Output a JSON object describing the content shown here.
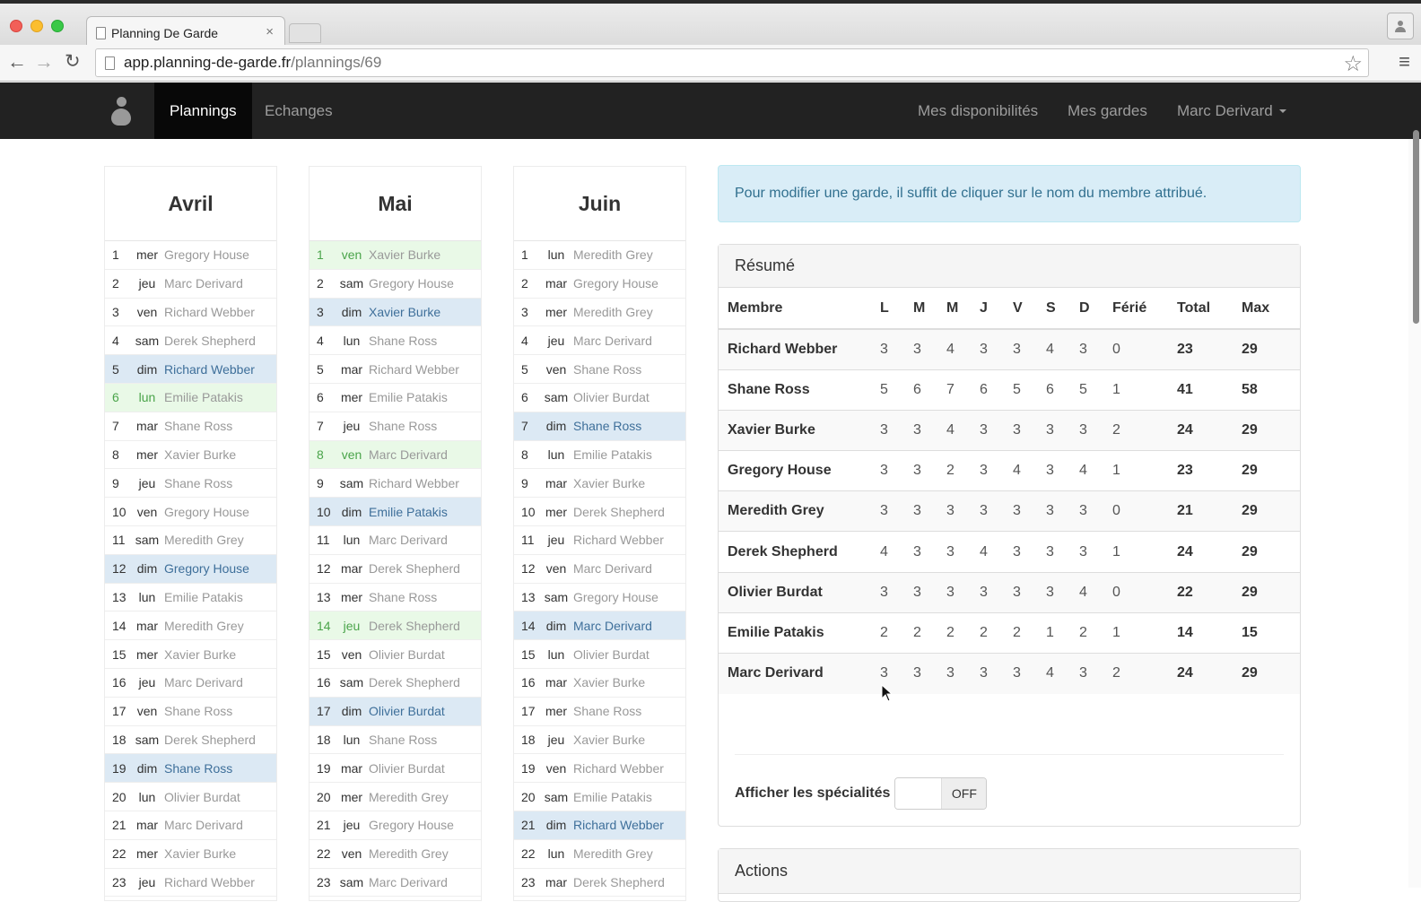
{
  "browser": {
    "tab_title": "Planning De Garde",
    "tab_close": "×",
    "url_host": "app.planning-de-garde.fr",
    "url_path": "/plannings/69",
    "back": "←",
    "forward": "→",
    "reload": "↻",
    "star": "☆",
    "menu": "≡",
    "profile": "👤"
  },
  "navbar": {
    "items_left": [
      {
        "label": "Plannings",
        "active": true
      },
      {
        "label": "Echanges",
        "active": false
      }
    ],
    "items_right": [
      {
        "label": "Mes disponibilités"
      },
      {
        "label": "Mes gardes"
      },
      {
        "label": "Marc Derivard"
      }
    ]
  },
  "months": [
    {
      "name": "Avril",
      "days": [
        {
          "num": "1",
          "day": "mer",
          "member": "Gregory House",
          "type": "normal"
        },
        {
          "num": "2",
          "day": "jeu",
          "member": "Marc Derivard",
          "type": "normal"
        },
        {
          "num": "3",
          "day": "ven",
          "member": "Richard Webber",
          "type": "normal"
        },
        {
          "num": "4",
          "day": "sam",
          "member": "Derek Shepherd",
          "type": "normal"
        },
        {
          "num": "5",
          "day": "dim",
          "member": "Richard Webber",
          "type": "sunday"
        },
        {
          "num": "6",
          "day": "lun",
          "member": "Emilie Patakis",
          "type": "holiday"
        },
        {
          "num": "7",
          "day": "mar",
          "member": "Shane Ross",
          "type": "normal"
        },
        {
          "num": "8",
          "day": "mer",
          "member": "Xavier Burke",
          "type": "normal"
        },
        {
          "num": "9",
          "day": "jeu",
          "member": "Shane Ross",
          "type": "normal"
        },
        {
          "num": "10",
          "day": "ven",
          "member": "Gregory House",
          "type": "normal"
        },
        {
          "num": "11",
          "day": "sam",
          "member": "Meredith Grey",
          "type": "normal"
        },
        {
          "num": "12",
          "day": "dim",
          "member": "Gregory House",
          "type": "sunday"
        },
        {
          "num": "13",
          "day": "lun",
          "member": "Emilie Patakis",
          "type": "normal"
        },
        {
          "num": "14",
          "day": "mar",
          "member": "Meredith Grey",
          "type": "normal"
        },
        {
          "num": "15",
          "day": "mer",
          "member": "Xavier Burke",
          "type": "normal"
        },
        {
          "num": "16",
          "day": "jeu",
          "member": "Marc Derivard",
          "type": "normal"
        },
        {
          "num": "17",
          "day": "ven",
          "member": "Shane Ross",
          "type": "normal"
        },
        {
          "num": "18",
          "day": "sam",
          "member": "Derek Shepherd",
          "type": "normal"
        },
        {
          "num": "19",
          "day": "dim",
          "member": "Shane Ross",
          "type": "sunday"
        },
        {
          "num": "20",
          "day": "lun",
          "member": "Olivier Burdat",
          "type": "normal"
        },
        {
          "num": "21",
          "day": "mar",
          "member": "Marc Derivard",
          "type": "normal"
        },
        {
          "num": "22",
          "day": "mer",
          "member": "Xavier Burke",
          "type": "normal"
        },
        {
          "num": "23",
          "day": "jeu",
          "member": "Richard Webber",
          "type": "normal"
        }
      ]
    },
    {
      "name": "Mai",
      "days": [
        {
          "num": "1",
          "day": "ven",
          "member": "Xavier Burke",
          "type": "holiday"
        },
        {
          "num": "2",
          "day": "sam",
          "member": "Gregory House",
          "type": "normal"
        },
        {
          "num": "3",
          "day": "dim",
          "member": "Xavier Burke",
          "type": "sunday"
        },
        {
          "num": "4",
          "day": "lun",
          "member": "Shane Ross",
          "type": "normal"
        },
        {
          "num": "5",
          "day": "mar",
          "member": "Richard Webber",
          "type": "normal"
        },
        {
          "num": "6",
          "day": "mer",
          "member": "Emilie Patakis",
          "type": "normal"
        },
        {
          "num": "7",
          "day": "jeu",
          "member": "Shane Ross",
          "type": "normal"
        },
        {
          "num": "8",
          "day": "ven",
          "member": "Marc Derivard",
          "type": "holiday"
        },
        {
          "num": "9",
          "day": "sam",
          "member": "Richard Webber",
          "type": "normal"
        },
        {
          "num": "10",
          "day": "dim",
          "member": "Emilie Patakis",
          "type": "sunday"
        },
        {
          "num": "11",
          "day": "lun",
          "member": "Marc Derivard",
          "type": "normal"
        },
        {
          "num": "12",
          "day": "mar",
          "member": "Derek Shepherd",
          "type": "normal"
        },
        {
          "num": "13",
          "day": "mer",
          "member": "Shane Ross",
          "type": "normal"
        },
        {
          "num": "14",
          "day": "jeu",
          "member": "Derek Shepherd",
          "type": "holiday"
        },
        {
          "num": "15",
          "day": "ven",
          "member": "Olivier Burdat",
          "type": "normal"
        },
        {
          "num": "16",
          "day": "sam",
          "member": "Derek Shepherd",
          "type": "normal"
        },
        {
          "num": "17",
          "day": "dim",
          "member": "Olivier Burdat",
          "type": "sunday"
        },
        {
          "num": "18",
          "day": "lun",
          "member": "Shane Ross",
          "type": "normal"
        },
        {
          "num": "19",
          "day": "mar",
          "member": "Olivier Burdat",
          "type": "normal"
        },
        {
          "num": "20",
          "day": "mer",
          "member": "Meredith Grey",
          "type": "normal"
        },
        {
          "num": "21",
          "day": "jeu",
          "member": "Gregory House",
          "type": "normal"
        },
        {
          "num": "22",
          "day": "ven",
          "member": "Meredith Grey",
          "type": "normal"
        },
        {
          "num": "23",
          "day": "sam",
          "member": "Marc Derivard",
          "type": "normal"
        }
      ]
    },
    {
      "name": "Juin",
      "days": [
        {
          "num": "1",
          "day": "lun",
          "member": "Meredith Grey",
          "type": "normal"
        },
        {
          "num": "2",
          "day": "mar",
          "member": "Gregory House",
          "type": "normal"
        },
        {
          "num": "3",
          "day": "mer",
          "member": "Meredith Grey",
          "type": "normal"
        },
        {
          "num": "4",
          "day": "jeu",
          "member": "Marc Derivard",
          "type": "normal"
        },
        {
          "num": "5",
          "day": "ven",
          "member": "Shane Ross",
          "type": "normal"
        },
        {
          "num": "6",
          "day": "sam",
          "member": "Olivier Burdat",
          "type": "normal"
        },
        {
          "num": "7",
          "day": "dim",
          "member": "Shane Ross",
          "type": "sunday"
        },
        {
          "num": "8",
          "day": "lun",
          "member": "Emilie Patakis",
          "type": "normal"
        },
        {
          "num": "9",
          "day": "mar",
          "member": "Xavier Burke",
          "type": "normal"
        },
        {
          "num": "10",
          "day": "mer",
          "member": "Derek Shepherd",
          "type": "normal"
        },
        {
          "num": "11",
          "day": "jeu",
          "member": "Richard Webber",
          "type": "normal"
        },
        {
          "num": "12",
          "day": "ven",
          "member": "Marc Derivard",
          "type": "normal"
        },
        {
          "num": "13",
          "day": "sam",
          "member": "Gregory House",
          "type": "normal"
        },
        {
          "num": "14",
          "day": "dim",
          "member": "Marc Derivard",
          "type": "sunday"
        },
        {
          "num": "15",
          "day": "lun",
          "member": "Olivier Burdat",
          "type": "normal"
        },
        {
          "num": "16",
          "day": "mar",
          "member": "Xavier Burke",
          "type": "normal"
        },
        {
          "num": "17",
          "day": "mer",
          "member": "Shane Ross",
          "type": "normal"
        },
        {
          "num": "18",
          "day": "jeu",
          "member": "Xavier Burke",
          "type": "normal"
        },
        {
          "num": "19",
          "day": "ven",
          "member": "Richard Webber",
          "type": "normal"
        },
        {
          "num": "20",
          "day": "sam",
          "member": "Emilie Patakis",
          "type": "normal"
        },
        {
          "num": "21",
          "day": "dim",
          "member": "Richard Webber",
          "type": "sunday"
        },
        {
          "num": "22",
          "day": "lun",
          "member": "Meredith Grey",
          "type": "normal"
        },
        {
          "num": "23",
          "day": "mar",
          "member": "Derek Shepherd",
          "type": "normal"
        }
      ]
    }
  ],
  "info": {
    "text": "Pour modifier une garde, il suffit de cliquer sur le nom du membre attribué."
  },
  "summary": {
    "title": "Résumé",
    "columns": [
      "Membre",
      "L",
      "M",
      "M",
      "J",
      "V",
      "S",
      "D",
      "Férié",
      "Total",
      "Max"
    ],
    "rows": [
      {
        "member": "Richard Webber",
        "values": [
          "3",
          "3",
          "4",
          "3",
          "3",
          "4",
          "3",
          "0"
        ],
        "total": "23",
        "max": "29"
      },
      {
        "member": "Shane Ross",
        "values": [
          "5",
          "6",
          "7",
          "6",
          "5",
          "6",
          "5",
          "1"
        ],
        "total": "41",
        "max": "58"
      },
      {
        "member": "Xavier Burke",
        "values": [
          "3",
          "3",
          "4",
          "3",
          "3",
          "3",
          "3",
          "2"
        ],
        "total": "24",
        "max": "29"
      },
      {
        "member": "Gregory House",
        "values": [
          "3",
          "3",
          "2",
          "3",
          "4",
          "3",
          "4",
          "1"
        ],
        "total": "23",
        "max": "29"
      },
      {
        "member": "Meredith Grey",
        "values": [
          "3",
          "3",
          "3",
          "3",
          "3",
          "3",
          "3",
          "0"
        ],
        "total": "21",
        "max": "29"
      },
      {
        "member": "Derek Shepherd",
        "values": [
          "4",
          "3",
          "3",
          "4",
          "3",
          "3",
          "3",
          "1"
        ],
        "total": "24",
        "max": "29"
      },
      {
        "member": "Olivier Burdat",
        "values": [
          "3",
          "3",
          "3",
          "3",
          "3",
          "3",
          "4",
          "0"
        ],
        "total": "22",
        "max": "29"
      },
      {
        "member": "Emilie Patakis",
        "values": [
          "2",
          "2",
          "2",
          "2",
          "2",
          "1",
          "2",
          "1"
        ],
        "total": "14",
        "max": "15"
      },
      {
        "member": "Marc Derivard",
        "values": [
          "3",
          "3",
          "3",
          "3",
          "3",
          "4",
          "3",
          "2"
        ],
        "total": "24",
        "max": "29"
      }
    ],
    "toggle_label": "Afficher les spécialités",
    "toggle_state": "OFF"
  },
  "actions": {
    "title": "Actions"
  },
  "colors": {
    "navbar_bg": "#222222",
    "sunday_bg": "#dce9f4",
    "holiday_bg": "#e9f9e7",
    "alert_bg": "#d9edf7"
  }
}
